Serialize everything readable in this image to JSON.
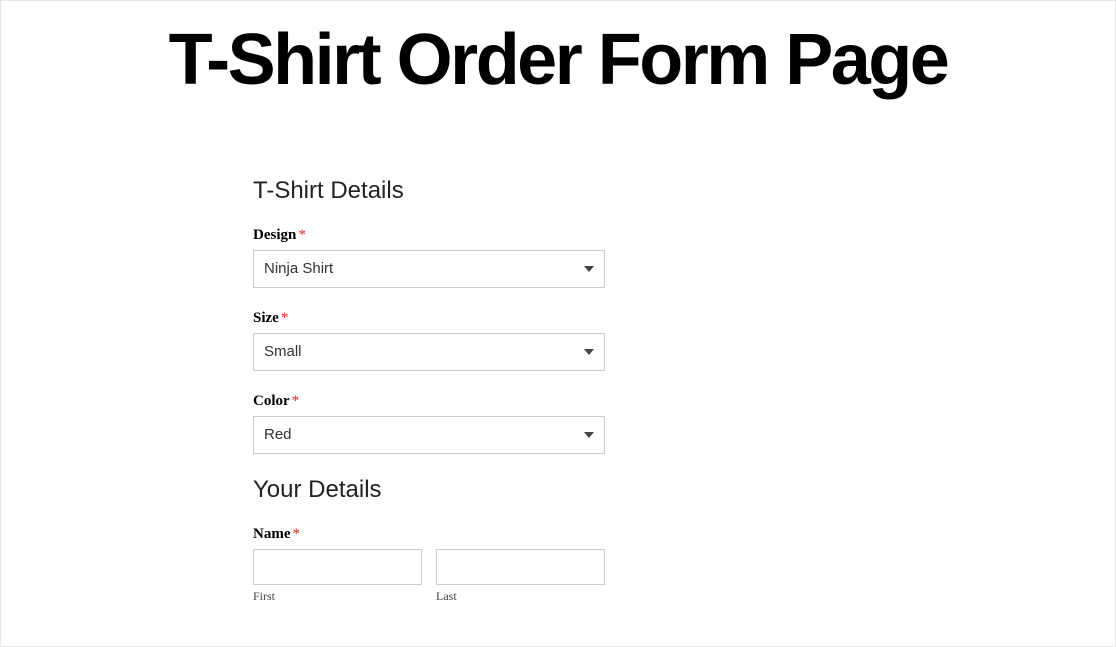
{
  "page": {
    "title": "T-Shirt Order Form Page"
  },
  "form": {
    "section1": {
      "heading": "T-Shirt Details",
      "design": {
        "label": "Design",
        "required": "*",
        "value": "Ninja Shirt"
      },
      "size": {
        "label": "Size",
        "required": "*",
        "value": "Small"
      },
      "color": {
        "label": "Color",
        "required": "*",
        "value": "Red"
      }
    },
    "section2": {
      "heading": "Your Details",
      "name": {
        "label": "Name",
        "required": "*",
        "first_sublabel": "First",
        "last_sublabel": "Last"
      }
    }
  }
}
